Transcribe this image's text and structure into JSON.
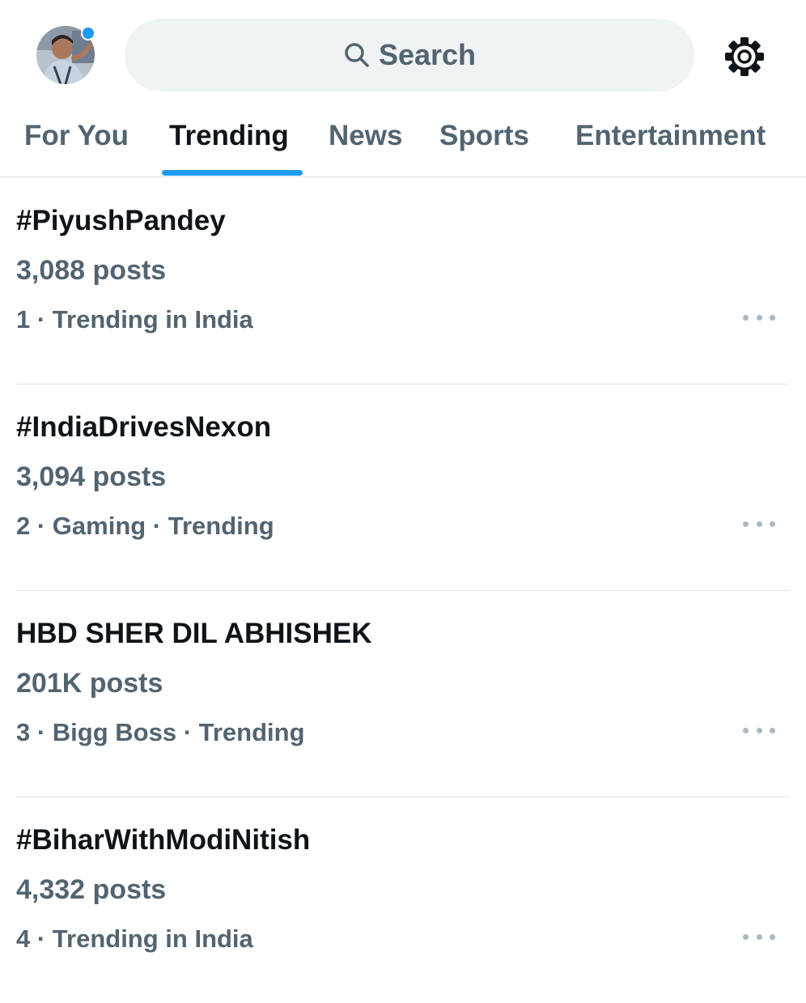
{
  "header": {
    "search": {
      "label": "Search",
      "icon": "search-icon"
    },
    "settings": {
      "icon": "gear-icon"
    },
    "avatar": {
      "notification_dot_color": "#1d9bf0"
    }
  },
  "tabs": [
    {
      "label": "For You",
      "active": false
    },
    {
      "label": "Trending",
      "active": true
    },
    {
      "label": "News",
      "active": false
    },
    {
      "label": "Sports",
      "active": false
    },
    {
      "label": "Entertainment",
      "active": false
    }
  ],
  "trends": [
    {
      "title": "#PiyushPandey",
      "posts": "3,088 posts",
      "context": "1 · Trending in India"
    },
    {
      "title": "#IndiaDrivesNexon",
      "posts": "3,094 posts",
      "context": "2 · Gaming · Trending"
    },
    {
      "title": "HBD SHER DIL ABHISHEK",
      "posts": "201K posts",
      "context": "3 · Bigg Boss · Trending"
    },
    {
      "title": "#BiharWithModiNitish",
      "posts": "4,332 posts",
      "context": "4 · Trending in India"
    }
  ],
  "colors": {
    "accent": "#1d9bf0",
    "primary_text": "#0f1419",
    "secondary_text": "#536471",
    "divider": "#dfe3e6",
    "search_background": "#eff3f4"
  }
}
